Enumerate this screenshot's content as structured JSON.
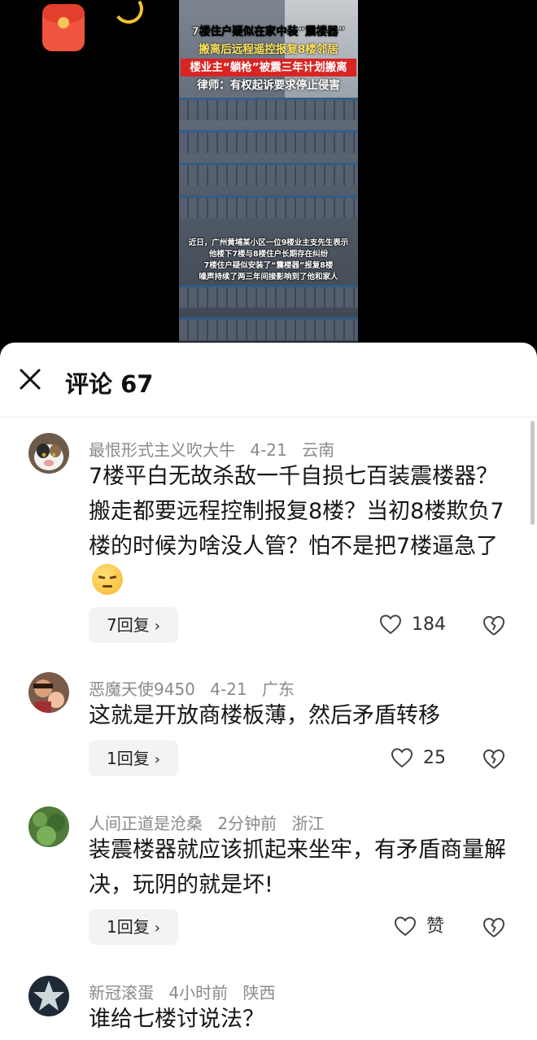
{
  "video": {
    "title_lines": [
      "7楼住户疑似在家中装“震楼器”",
      "搬离后远程遥控报复8楼邻居",
      "楼业主“躺枪”被震三年计划搬离",
      "律师：有权起诉要求停止侵害"
    ],
    "caption_lines": [
      "近日，广州黄埔某小区一位9楼业主支先生表示",
      "他楼下7楼与8楼住户长期存在纠纷",
      "7楼住户疑似安装了“震楼器”报复8楼",
      "噪声持续了两三年间接影响到了他和家人"
    ]
  },
  "comments_panel": {
    "title": "评论 67",
    "close_icon": "close-icon"
  },
  "comments": [
    {
      "user": "最恨形式主义吹大牛",
      "time": "4-21",
      "location": "云南",
      "text": "7楼平白无故杀敌一千自损七百装震楼器？搬走都要远程控制报复8楼？当初8楼欺负7楼的时候为啥没人管？怕不是把7楼逼急了",
      "emoji": "angry-face-emoji",
      "reply_label": "7回复",
      "likes": "184"
    },
    {
      "user": "恶魔天使9450",
      "time": "4-21",
      "location": "广东",
      "text": "这就是开放商楼板薄，然后矛盾转移",
      "reply_label": "1回复",
      "likes": "25"
    },
    {
      "user": "人间正道是沧桑",
      "time": "2分钟前",
      "location": "浙江",
      "text": "装震楼器就应该抓起来坐牢，有矛盾商量解决，玩阴的就是坏!",
      "reply_label": "1回复",
      "likes": "赞"
    },
    {
      "user": "新冠滚蛋",
      "time": "4小时前",
      "location": "陕西",
      "text": "谁给七楼讨说法？"
    }
  ],
  "icons": {
    "reply_chevron": "›",
    "heart": "heart-icon",
    "broken_heart": "broken-heart-icon"
  },
  "colors": {
    "accent_red": "#d92424",
    "meta_gray": "#8a8a8a",
    "reply_bg": "#f3f3f3"
  }
}
